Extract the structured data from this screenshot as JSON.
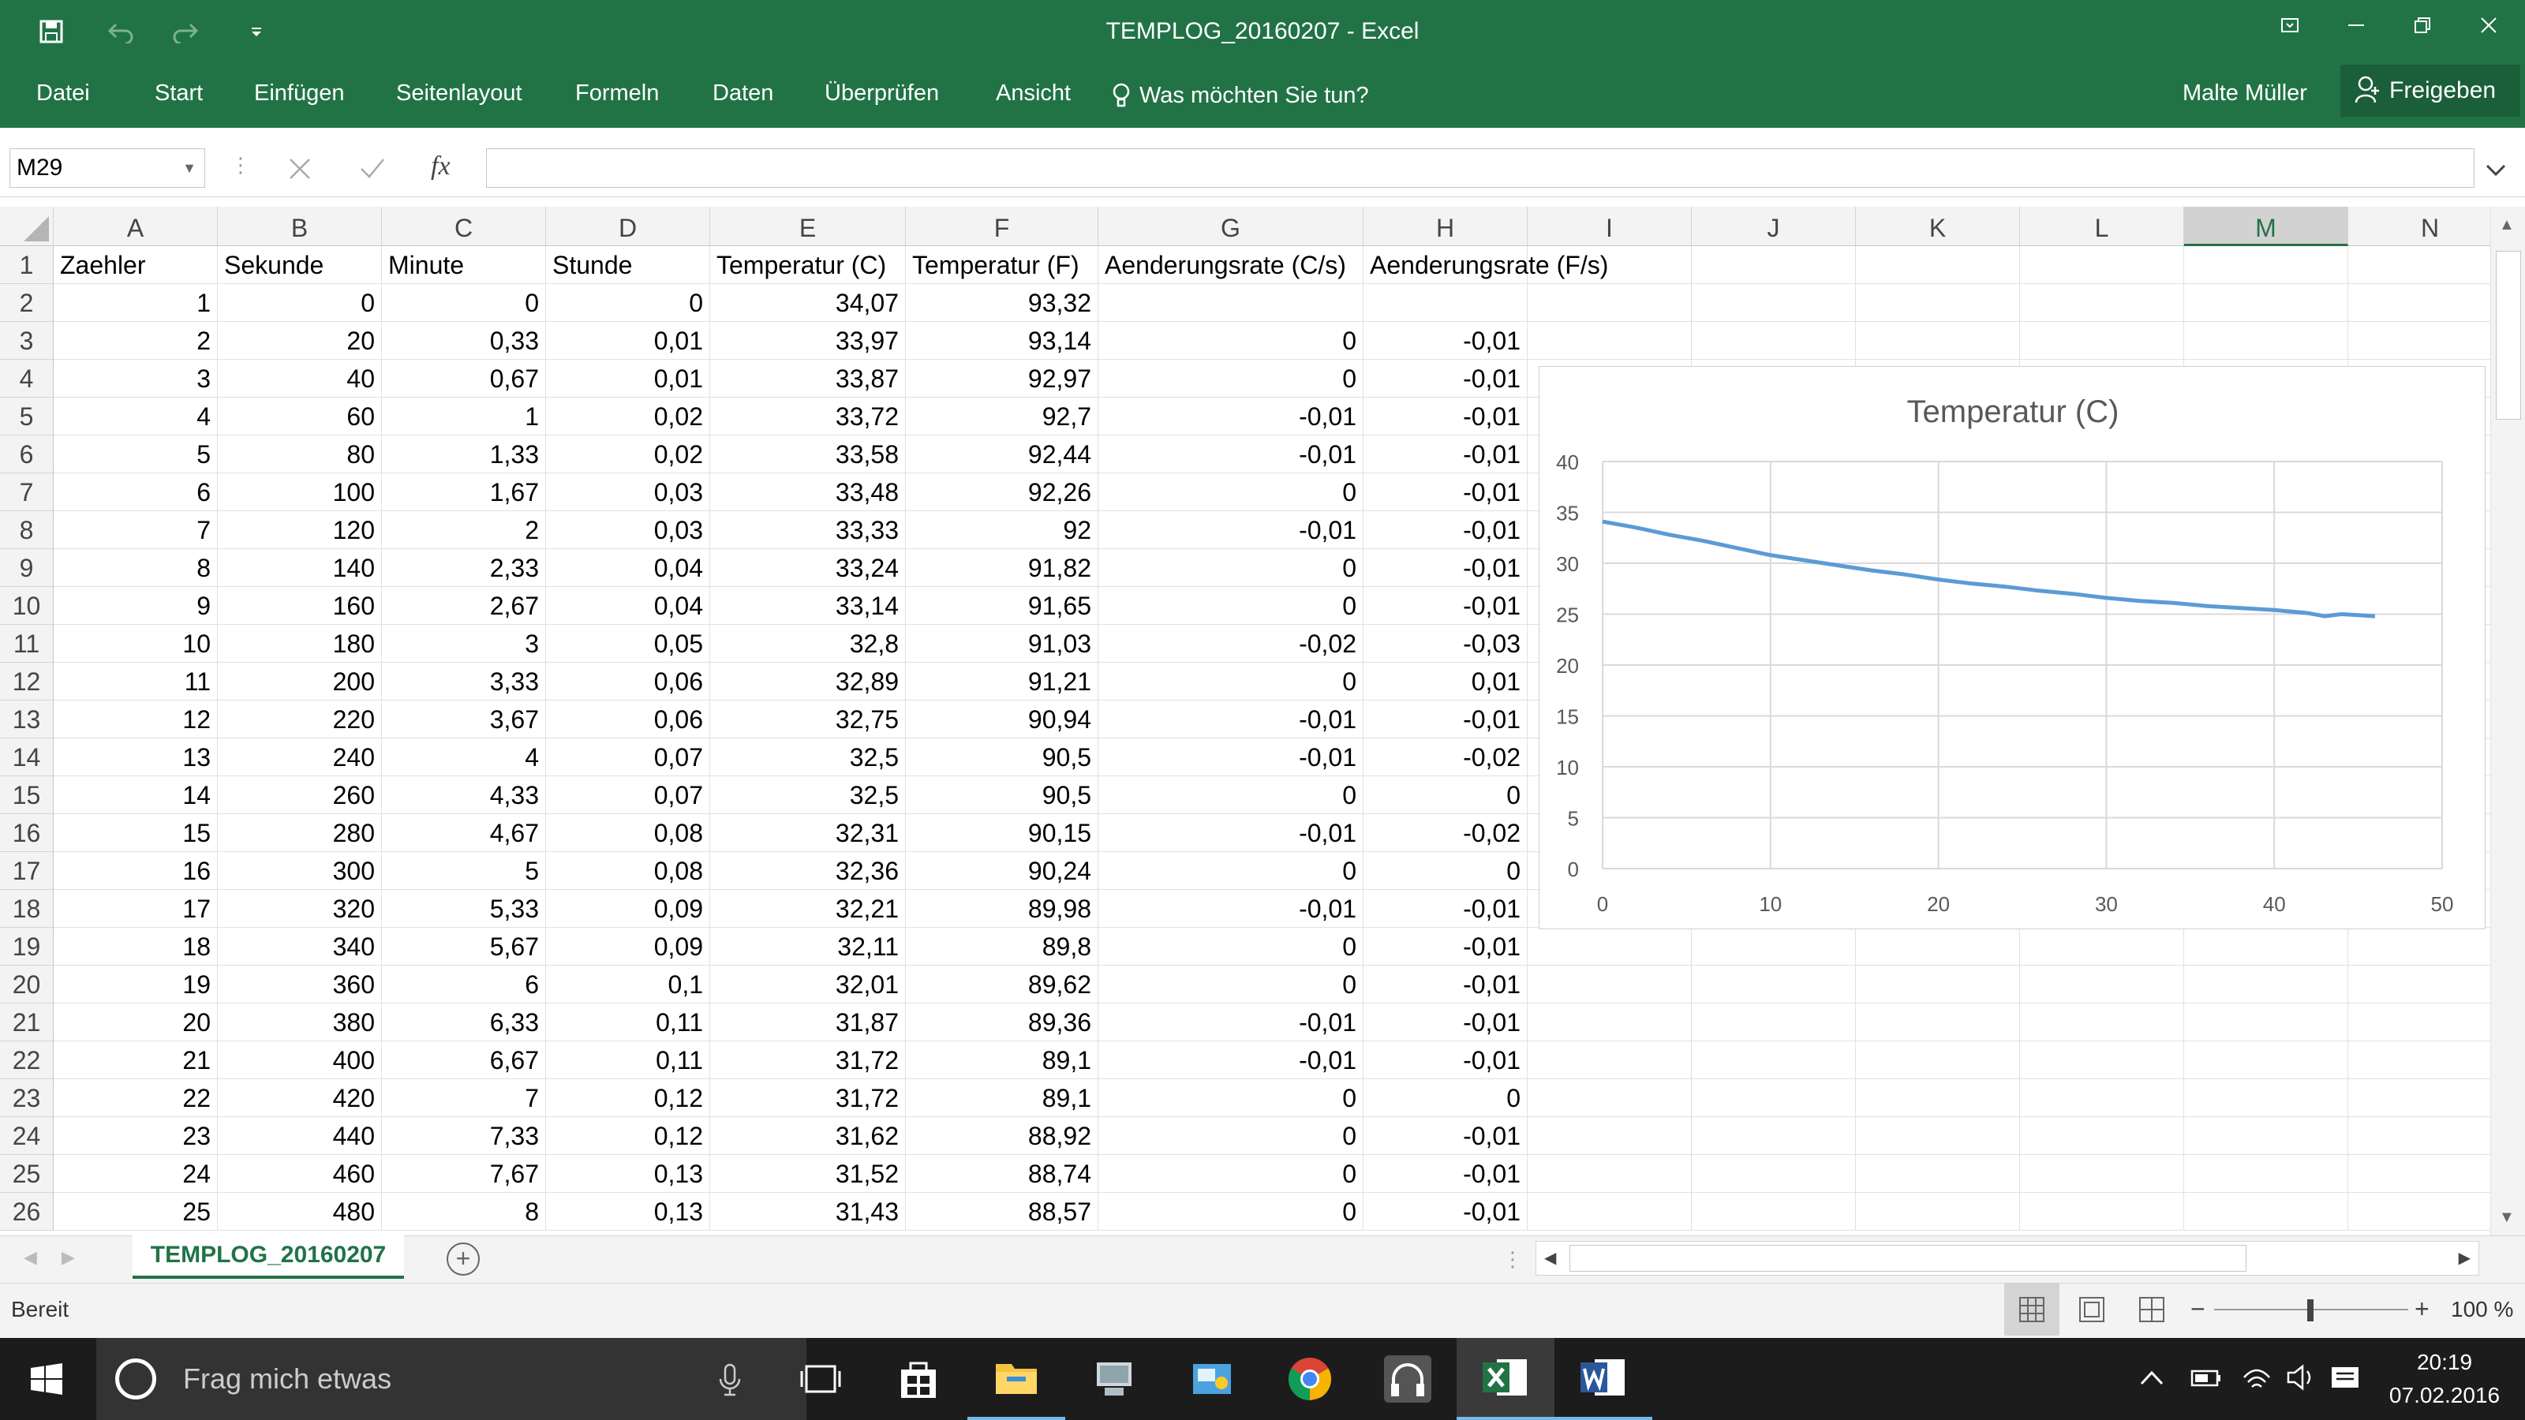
{
  "window": {
    "title": "TEMPLOG_20160207 - Excel"
  },
  "ribbon": {
    "tabs": [
      "Datei",
      "Start",
      "Einfügen",
      "Seitenlayout",
      "Formeln",
      "Daten",
      "Überprüfen",
      "Ansicht"
    ],
    "tell_me": "Was möchten Sie tun?",
    "user": "Malte Müller",
    "share": "Freigeben"
  },
  "formula": {
    "cell_ref": "M29",
    "content": ""
  },
  "columns": [
    "A",
    "B",
    "C",
    "D",
    "E",
    "F",
    "G",
    "H",
    "I",
    "J",
    "K",
    "L",
    "M",
    "N"
  ],
  "rows": [
    "1",
    "2",
    "3",
    "4",
    "5",
    "6",
    "7",
    "8",
    "9",
    "10",
    "11",
    "12",
    "13",
    "14",
    "15",
    "16",
    "17",
    "18",
    "19",
    "20",
    "21",
    "22",
    "23",
    "24",
    "25",
    "26"
  ],
  "headers": [
    "Zaehler",
    "Sekunde",
    "Minute",
    "Stunde",
    "Temperatur (C)",
    "Temperatur (F)",
    "Aenderungsrate (C/s)",
    "Aenderungsrate (F/s)"
  ],
  "table": [
    [
      "1",
      "0",
      "0",
      "0",
      "34,07",
      "93,32",
      "",
      ""
    ],
    [
      "2",
      "20",
      "0,33",
      "0,01",
      "33,97",
      "93,14",
      "0",
      "-0,01"
    ],
    [
      "3",
      "40",
      "0,67",
      "0,01",
      "33,87",
      "92,97",
      "0",
      "-0,01"
    ],
    [
      "4",
      "60",
      "1",
      "0,02",
      "33,72",
      "92,7",
      "-0,01",
      "-0,01"
    ],
    [
      "5",
      "80",
      "1,33",
      "0,02",
      "33,58",
      "92,44",
      "-0,01",
      "-0,01"
    ],
    [
      "6",
      "100",
      "1,67",
      "0,03",
      "33,48",
      "92,26",
      "0",
      "-0,01"
    ],
    [
      "7",
      "120",
      "2",
      "0,03",
      "33,33",
      "92",
      "-0,01",
      "-0,01"
    ],
    [
      "8",
      "140",
      "2,33",
      "0,04",
      "33,24",
      "91,82",
      "0",
      "-0,01"
    ],
    [
      "9",
      "160",
      "2,67",
      "0,04",
      "33,14",
      "91,65",
      "0",
      "-0,01"
    ],
    [
      "10",
      "180",
      "3",
      "0,05",
      "32,8",
      "91,03",
      "-0,02",
      "-0,03"
    ],
    [
      "11",
      "200",
      "3,33",
      "0,06",
      "32,89",
      "91,21",
      "0",
      "0,01"
    ],
    [
      "12",
      "220",
      "3,67",
      "0,06",
      "32,75",
      "90,94",
      "-0,01",
      "-0,01"
    ],
    [
      "13",
      "240",
      "4",
      "0,07",
      "32,5",
      "90,5",
      "-0,01",
      "-0,02"
    ],
    [
      "14",
      "260",
      "4,33",
      "0,07",
      "32,5",
      "90,5",
      "0",
      "0"
    ],
    [
      "15",
      "280",
      "4,67",
      "0,08",
      "32,31",
      "90,15",
      "-0,01",
      "-0,02"
    ],
    [
      "16",
      "300",
      "5",
      "0,08",
      "32,36",
      "90,24",
      "0",
      "0"
    ],
    [
      "17",
      "320",
      "5,33",
      "0,09",
      "32,21",
      "89,98",
      "-0,01",
      "-0,01"
    ],
    [
      "18",
      "340",
      "5,67",
      "0,09",
      "32,11",
      "89,8",
      "0",
      "-0,01"
    ],
    [
      "19",
      "360",
      "6",
      "0,1",
      "32,01",
      "89,62",
      "0",
      "-0,01"
    ],
    [
      "20",
      "380",
      "6,33",
      "0,11",
      "31,87",
      "89,36",
      "-0,01",
      "-0,01"
    ],
    [
      "21",
      "400",
      "6,67",
      "0,11",
      "31,72",
      "89,1",
      "-0,01",
      "-0,01"
    ],
    [
      "22",
      "420",
      "7",
      "0,12",
      "31,72",
      "89,1",
      "0",
      "0"
    ],
    [
      "23",
      "440",
      "7,33",
      "0,12",
      "31,62",
      "88,92",
      "0",
      "-0,01"
    ],
    [
      "24",
      "460",
      "7,67",
      "0,13",
      "31,52",
      "88,74",
      "0",
      "-0,01"
    ],
    [
      "25",
      "480",
      "8",
      "0,13",
      "31,43",
      "88,57",
      "0",
      "-0,01"
    ]
  ],
  "chart_data": {
    "type": "line",
    "title": "Temperatur (C)",
    "xlim": [
      0,
      50
    ],
    "ylim": [
      0,
      40
    ],
    "x_ticks": [
      "0",
      "10",
      "20",
      "30",
      "40",
      "50"
    ],
    "y_ticks": [
      "0",
      "5",
      "10",
      "15",
      "20",
      "25",
      "30",
      "35",
      "40"
    ],
    "grid": true,
    "color": "#5b9bd5",
    "x": [
      0,
      2,
      4,
      6,
      8,
      10,
      12,
      14,
      16,
      18,
      20,
      22,
      24,
      26,
      28,
      30,
      32,
      34,
      36,
      38,
      40,
      42,
      43,
      44,
      45,
      46
    ],
    "y": [
      34.1,
      33.5,
      32.8,
      32.2,
      31.5,
      30.8,
      30.3,
      29.8,
      29.3,
      28.9,
      28.4,
      28.0,
      27.7,
      27.3,
      27.0,
      26.6,
      26.3,
      26.1,
      25.8,
      25.6,
      25.4,
      25.1,
      24.8,
      25.0,
      24.9,
      24.8
    ]
  },
  "sheet": {
    "tab": "TEMPLOG_20160207"
  },
  "status": {
    "text": "Bereit",
    "zoom": "100 %"
  },
  "taskbar": {
    "search": "Frag mich etwas",
    "time": "20:19",
    "date": "07.02.2016"
  },
  "colors": {
    "excel_green": "#217346",
    "line": "#5b9bd5",
    "taskbar": "#1c1c1c"
  }
}
